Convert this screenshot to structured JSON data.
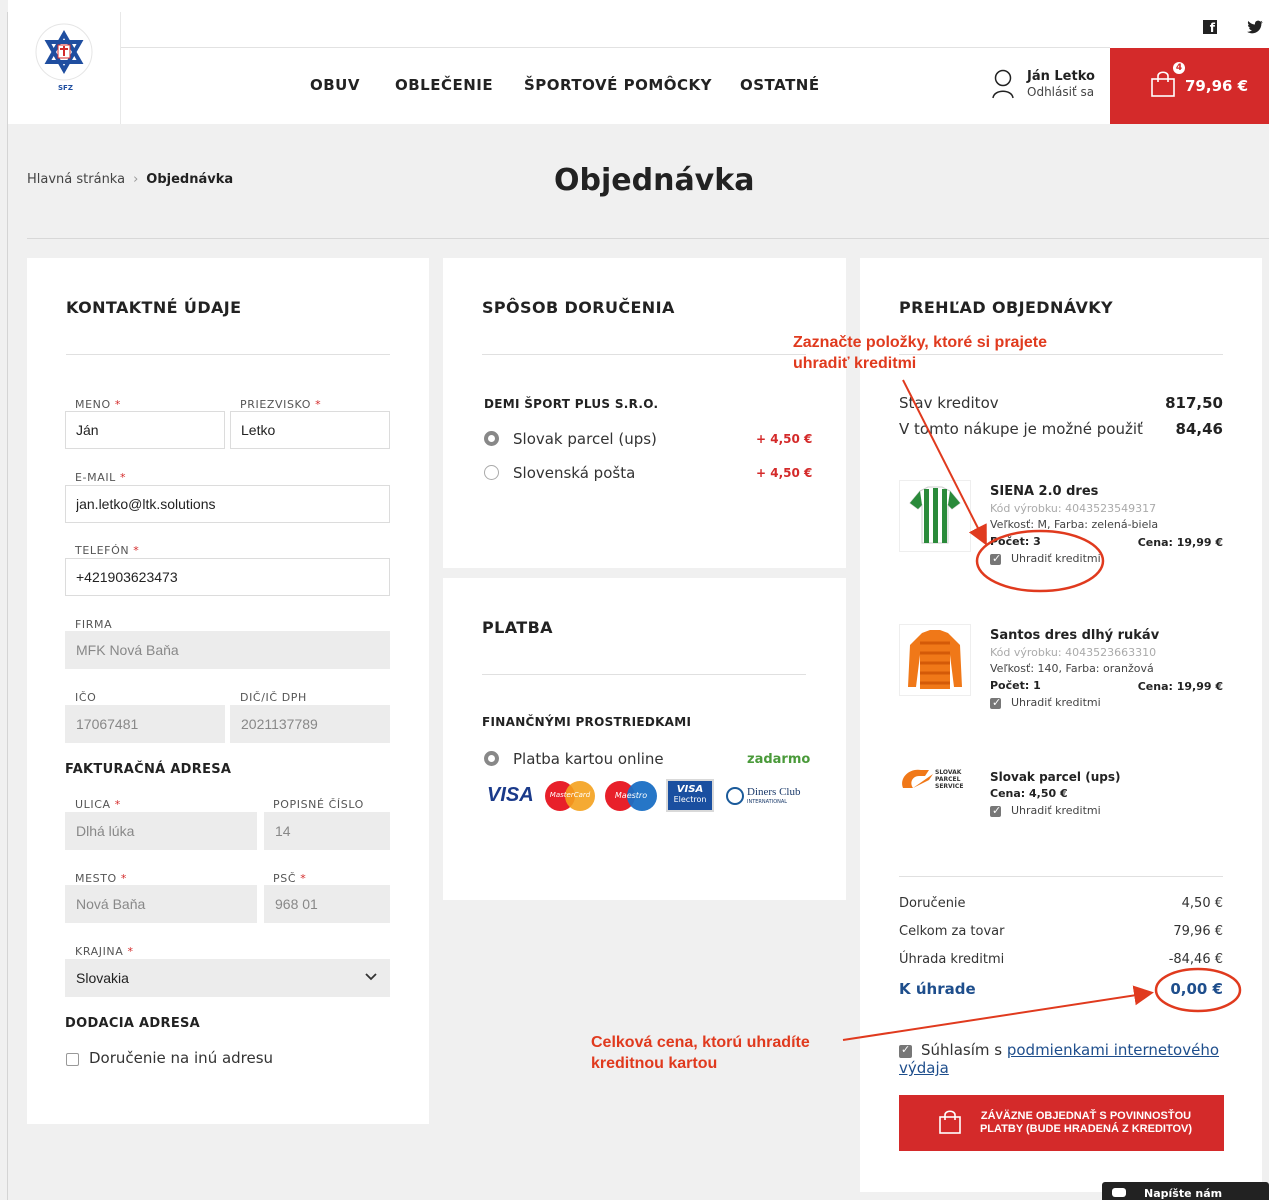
{
  "header": {
    "logo_text": "SLOVENSKÝ FUTBALOVÝ ZVÄZ",
    "logo_abbr": "SFZ",
    "nav": [
      "OBUV",
      "OBLEČENIE",
      "ŠPORTOVÉ POMÔCKY",
      "OSTATNÉ"
    ],
    "user_name": "Ján Letko",
    "logout_label": "Odhlásiť sa",
    "cart_total": "79,96 €",
    "cart_count": "4",
    "social": [
      "facebook-icon",
      "twitter-icon"
    ]
  },
  "breadcrumb": {
    "home": "Hlavná stránka",
    "current": "Objednávka"
  },
  "page_title": "Objednávka",
  "contact": {
    "title": "KONTAKTNÉ ÚDAJE",
    "first_name_label": "MENO",
    "first_name": "Ján",
    "last_name_label": "PRIEZVISKO",
    "last_name": "Letko",
    "email_label": "E-MAIL",
    "email": "jan.letko@ltk.solutions",
    "phone_label": "TELEFÓN",
    "phone": "+421903623473",
    "company_label": "FIRMA",
    "company": "MFK Nová Baňa",
    "ico_label": "IČO",
    "ico": "17067481",
    "dic_label": "DIČ/IČ DPH",
    "dic": "2021137789",
    "billing_title": "FAKTURAČNÁ ADRESA",
    "street_label": "ULICA",
    "street": "Dlhá lúka",
    "number_label": "POPISNÉ ČÍSLO",
    "number": "14",
    "city_label": "MESTO",
    "city": "Nová Baňa",
    "zip_label": "PSČ",
    "zip": "968 01",
    "country_label": "KRAJINA",
    "country": "Slovakia",
    "delivery_title": "DODACIA ADRESA",
    "other_address_label": "Doručenie na inú adresu",
    "required_mark": "*"
  },
  "shipping": {
    "title": "SPÔSOB DORUČENIA",
    "provider": "DEMI ŠPORT PLUS S.R.O.",
    "options": [
      {
        "label": "Slovak parcel (ups)",
        "price": "+ 4,50 €",
        "selected": true
      },
      {
        "label": "Slovenská pošta",
        "price": "+ 4,50 €",
        "selected": false
      }
    ]
  },
  "payment": {
    "title": "PLATBA",
    "group": "FINANČNÝMI PROSTRIEDKAMI",
    "option_label": "Platba kartou online",
    "option_price": "zadarmo",
    "cards": {
      "visa": "VISA",
      "mastercard": "MasterCard",
      "maestro": "Maestro",
      "visa_electron_1": "VISA",
      "visa_electron_2": "Electron",
      "diners_1": "Diners Club",
      "diners_2": "INTERNATIONAL"
    }
  },
  "summary": {
    "title": "PREHĽAD OBJEDNÁVKY",
    "credit_label": "Stav kreditov",
    "credit_value": "817,50",
    "usable_label": "V tomto nákupe je možné použiť",
    "usable_value": "84,46",
    "items": [
      {
        "name": "SIENA 2.0 dres",
        "code": "Kód výrobku: 4043523549317",
        "variant": "Veľkosť: M, Farba: zelená-biela",
        "qty": "Počet: 3",
        "price": "Cena: 19,99 €",
        "pay_label": "Uhradiť kreditmi"
      },
      {
        "name": "Santos dres dlhý rukáv",
        "code": "Kód výrobku: 4043523663310",
        "variant": "Veľkosť: 140, Farba: oranžová",
        "qty": "Počet: 1",
        "price": "Cena: 19,99 €",
        "pay_label": "Uhradiť kreditmi"
      }
    ],
    "shipping_item": {
      "name": "Slovak parcel (ups)",
      "price": "Cena: 4,50 €",
      "pay_label": "Uhradiť kreditmi",
      "logo_text_1": "SLOVAK",
      "logo_text_2": "PARCEL",
      "logo_text_3": "SERVICE"
    },
    "delivery_label": "Doručenie",
    "delivery_value": "4,50 €",
    "goods_label": "Celkom za tovar",
    "goods_value": "79,96 €",
    "credit_pay_label": "Úhrada kreditmi",
    "credit_pay_value": "-84,46 €",
    "total_label": "K úhrade",
    "total_value": "0,00 €",
    "agree_prefix": "Súhlasím s ",
    "agree_link": "podmienkami internetového výdaja",
    "order_button": "ZÁVÄZNE OBJEDNAŤ S POVINNOSŤOU PLATBY (BUDE HRADENÁ Z KREDITOV)"
  },
  "annotations": {
    "top": "Zaznačte položky, ktoré si prajete uhradiť kreditmi",
    "bottom": "Celková cena, ktorú uhradíte kreditnou kartou",
    "color": "#e03a1e"
  },
  "chat": {
    "label": "Napíšte nám"
  },
  "colors": {
    "brand_red": "#d42a2a",
    "link_blue": "#1e4e8c",
    "free_green": "#4a9a3a"
  }
}
